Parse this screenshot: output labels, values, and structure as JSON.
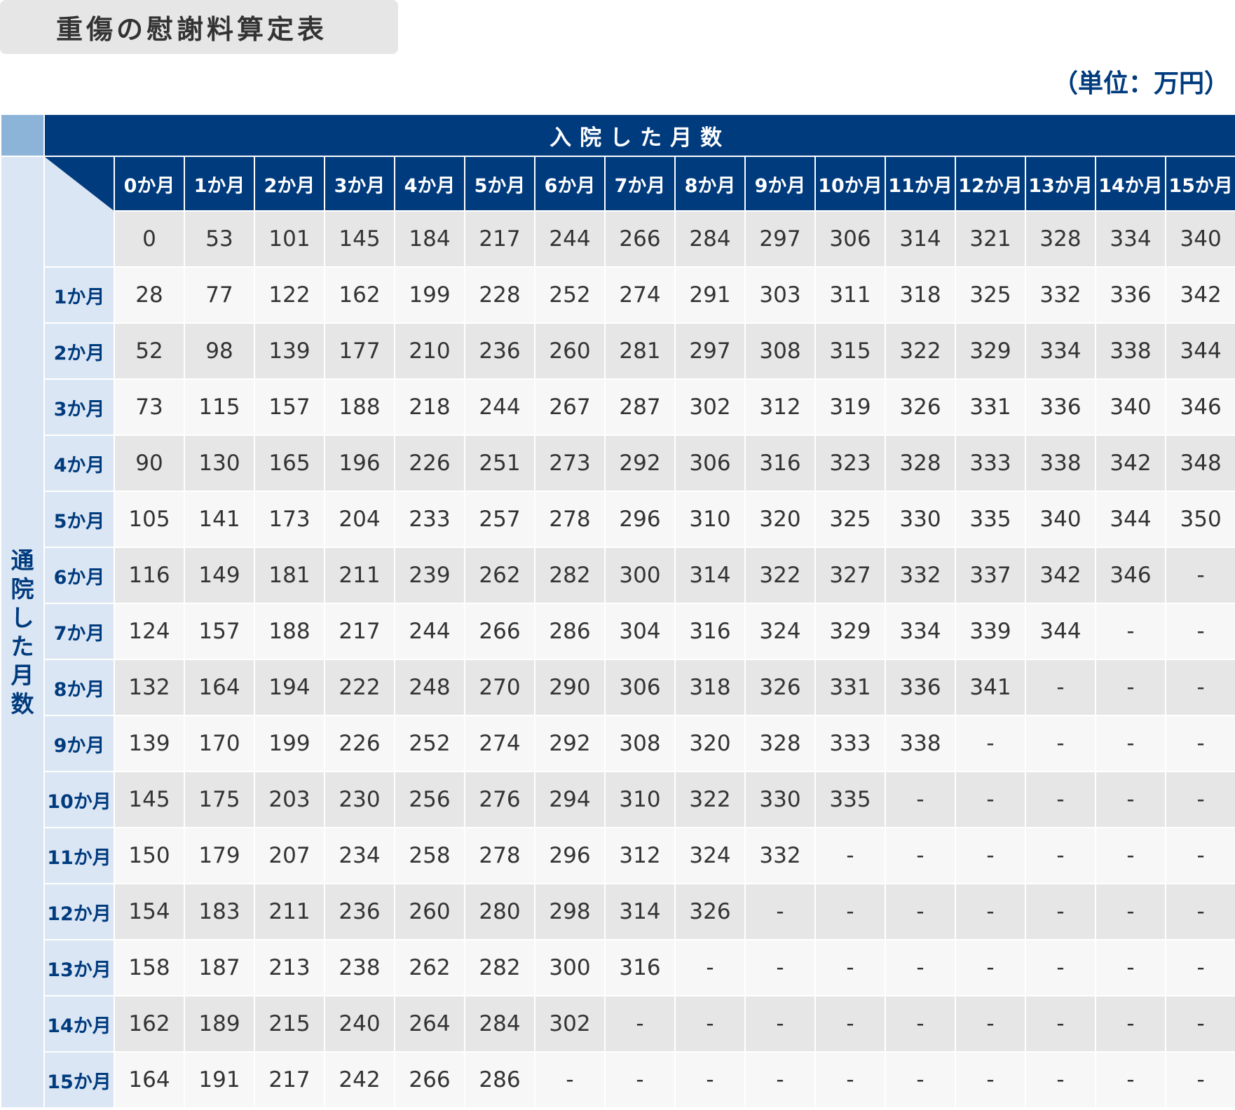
{
  "title": "重傷の慰謝料算定表",
  "unit": "（単位：万円）",
  "top_header": "入院した月数",
  "side_header": [
    "通",
    "院",
    "し",
    "た",
    "月",
    "数"
  ],
  "columns": [
    "0か月",
    "1か月",
    "2か月",
    "3か月",
    "4か月",
    "5か月",
    "6か月",
    "7か月",
    "8か月",
    "9か月",
    "10か月",
    "11か月",
    "12か月",
    "13か月",
    "14か月",
    "15か月"
  ],
  "rows": [
    {
      "label": "",
      "values": [
        "0",
        "53",
        "101",
        "145",
        "184",
        "217",
        "244",
        "266",
        "284",
        "297",
        "306",
        "314",
        "321",
        "328",
        "334",
        "340"
      ]
    },
    {
      "label": "1か月",
      "values": [
        "28",
        "77",
        "122",
        "162",
        "199",
        "228",
        "252",
        "274",
        "291",
        "303",
        "311",
        "318",
        "325",
        "332",
        "336",
        "342"
      ]
    },
    {
      "label": "2か月",
      "values": [
        "52",
        "98",
        "139",
        "177",
        "210",
        "236",
        "260",
        "281",
        "297",
        "308",
        "315",
        "322",
        "329",
        "334",
        "338",
        "344"
      ]
    },
    {
      "label": "3か月",
      "values": [
        "73",
        "115",
        "157",
        "188",
        "218",
        "244",
        "267",
        "287",
        "302",
        "312",
        "319",
        "326",
        "331",
        "336",
        "340",
        "346"
      ]
    },
    {
      "label": "4か月",
      "values": [
        "90",
        "130",
        "165",
        "196",
        "226",
        "251",
        "273",
        "292",
        "306",
        "316",
        "323",
        "328",
        "333",
        "338",
        "342",
        "348"
      ]
    },
    {
      "label": "5か月",
      "values": [
        "105",
        "141",
        "173",
        "204",
        "233",
        "257",
        "278",
        "296",
        "310",
        "320",
        "325",
        "330",
        "335",
        "340",
        "344",
        "350"
      ]
    },
    {
      "label": "6か月",
      "values": [
        "116",
        "149",
        "181",
        "211",
        "239",
        "262",
        "282",
        "300",
        "314",
        "322",
        "327",
        "332",
        "337",
        "342",
        "346",
        "-"
      ]
    },
    {
      "label": "7か月",
      "values": [
        "124",
        "157",
        "188",
        "217",
        "244",
        "266",
        "286",
        "304",
        "316",
        "324",
        "329",
        "334",
        "339",
        "344",
        "-",
        "-"
      ]
    },
    {
      "label": "8か月",
      "values": [
        "132",
        "164",
        "194",
        "222",
        "248",
        "270",
        "290",
        "306",
        "318",
        "326",
        "331",
        "336",
        "341",
        "-",
        "-",
        "-"
      ]
    },
    {
      "label": "9か月",
      "values": [
        "139",
        "170",
        "199",
        "226",
        "252",
        "274",
        "292",
        "308",
        "320",
        "328",
        "333",
        "338",
        "-",
        "-",
        "-",
        "-"
      ]
    },
    {
      "label": "10か月",
      "values": [
        "145",
        "175",
        "203",
        "230",
        "256",
        "276",
        "294",
        "310",
        "322",
        "330",
        "335",
        "-",
        "-",
        "-",
        "-",
        "-"
      ]
    },
    {
      "label": "11か月",
      "values": [
        "150",
        "179",
        "207",
        "234",
        "258",
        "278",
        "296",
        "312",
        "324",
        "332",
        "-",
        "-",
        "-",
        "-",
        "-",
        "-"
      ]
    },
    {
      "label": "12か月",
      "values": [
        "154",
        "183",
        "211",
        "236",
        "260",
        "280",
        "298",
        "314",
        "326",
        "-",
        "-",
        "-",
        "-",
        "-",
        "-",
        "-"
      ]
    },
    {
      "label": "13か月",
      "values": [
        "158",
        "187",
        "213",
        "238",
        "262",
        "282",
        "300",
        "316",
        "-",
        "-",
        "-",
        "-",
        "-",
        "-",
        "-",
        "-"
      ]
    },
    {
      "label": "14か月",
      "values": [
        "162",
        "189",
        "215",
        "240",
        "264",
        "284",
        "302",
        "-",
        "-",
        "-",
        "-",
        "-",
        "-",
        "-",
        "-",
        "-"
      ]
    },
    {
      "label": "15か月",
      "values": [
        "164",
        "191",
        "217",
        "242",
        "266",
        "286",
        "-",
        "-",
        "-",
        "-",
        "-",
        "-",
        "-",
        "-",
        "-",
        "-"
      ]
    }
  ],
  "colors": {
    "header_navy": "#003b7e",
    "side_light_blue": "#dbe6f4",
    "corner_blue": "#8cb4d8",
    "row_shade": "#e6e6e6",
    "row_plain": "#f7f7f7"
  }
}
